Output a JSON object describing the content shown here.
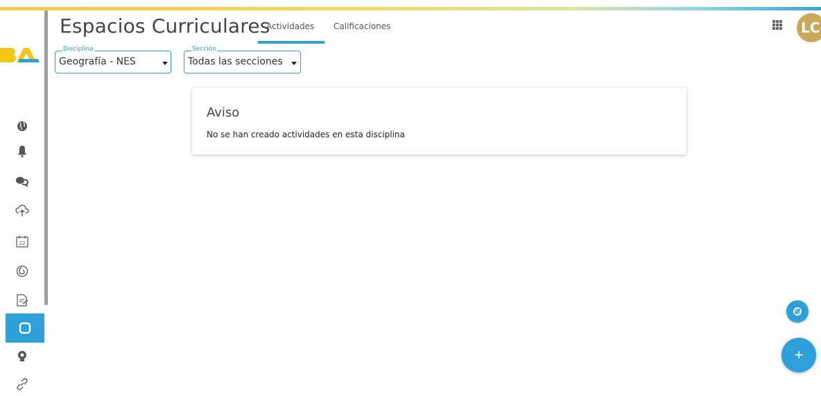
{
  "header": {
    "title": "Espacios Curriculares",
    "tabs": [
      {
        "label": "Actividades",
        "active": true
      },
      {
        "label": "Calificaciones",
        "active": false
      }
    ],
    "avatar_initials": "LC"
  },
  "logo": {
    "text": "BA"
  },
  "filters": {
    "disciplina": {
      "label": "Disciplina",
      "value": "Geografía - NES"
    },
    "seccion": {
      "label": "Sección",
      "value": "Todas las secciones"
    }
  },
  "notice": {
    "title": "Aviso",
    "message": "No se han creado actividades en esta disciplina"
  },
  "sidebar": {
    "items": [
      {
        "icon": "globe-icon"
      },
      {
        "icon": "bell-icon"
      },
      {
        "icon": "chat-icon"
      },
      {
        "icon": "cloud-upload-icon"
      },
      {
        "icon": "calendar-icon",
        "badge": "22"
      },
      {
        "icon": "spiral-icon"
      },
      {
        "icon": "edit-document-icon"
      },
      {
        "icon": "square-icon",
        "active": true
      },
      {
        "icon": "lightbulb-icon"
      },
      {
        "icon": "link-icon"
      }
    ]
  },
  "fab": {
    "add_label": "+"
  },
  "colors": {
    "accent": "#2d9fd9",
    "avatar": "#c9a85a"
  }
}
